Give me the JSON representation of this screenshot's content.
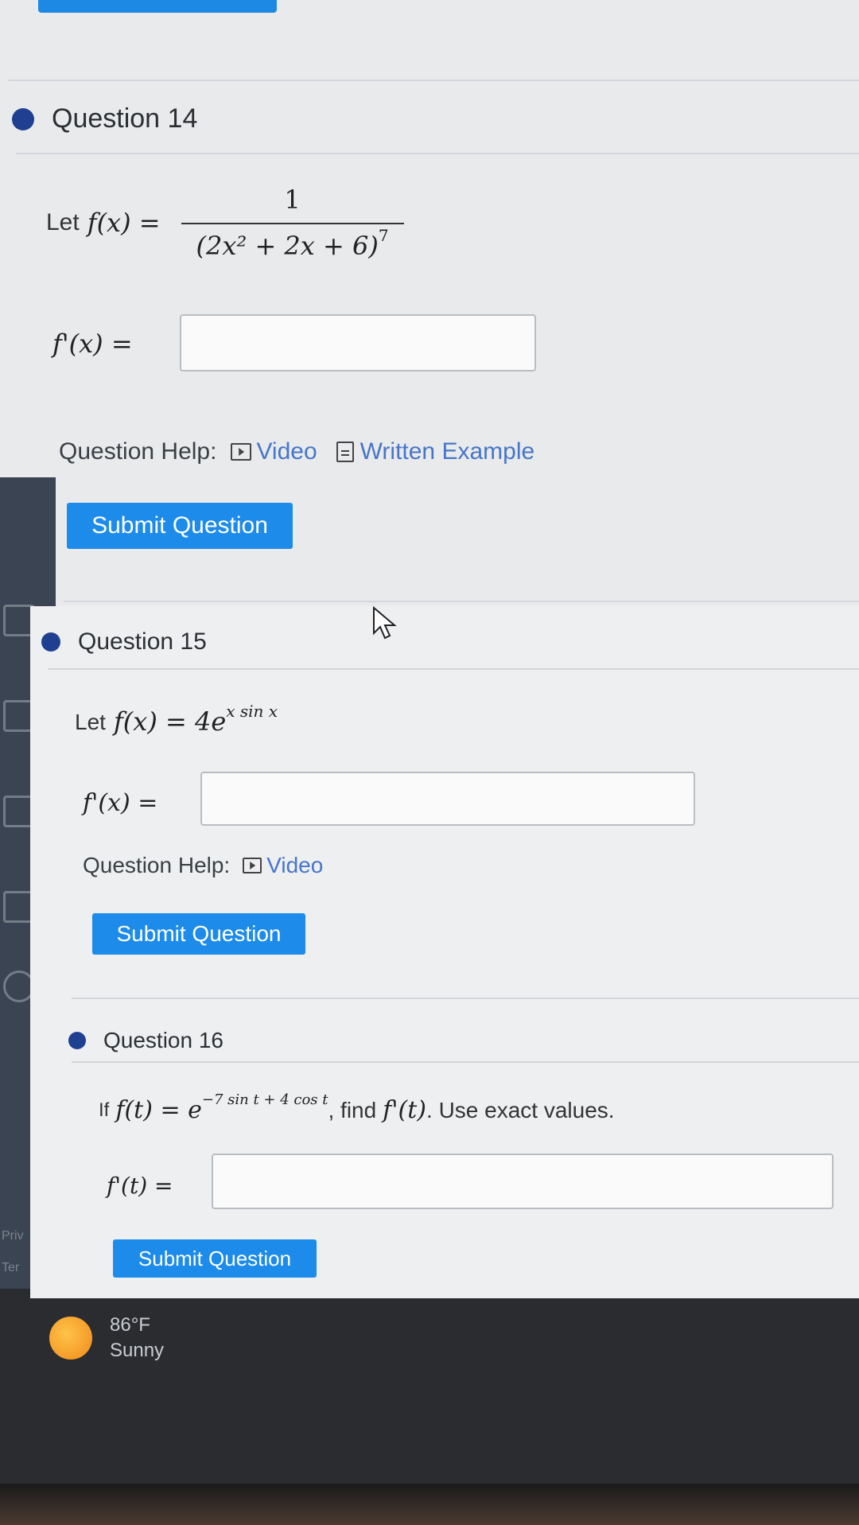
{
  "questions": [
    {
      "title": "Question 14",
      "prompt_prefix": "Let",
      "func": "f(x) =",
      "numerator": "1",
      "denominator": "(2x² + 2x + 6)",
      "exponent": "7",
      "answer_label": "f'(x) =",
      "answer_value": "",
      "help_label": "Question Help:",
      "help_links": [
        "Video",
        "Written Example"
      ],
      "submit_label": "Submit Question"
    },
    {
      "title": "Question 15",
      "prompt_prefix": "Let",
      "func": "f(x) = 4e",
      "exponent": "x sin x",
      "answer_label": "f'(x) =",
      "answer_value": "",
      "help_label": "Question Help:",
      "help_links": [
        "Video"
      ],
      "submit_label": "Submit Question"
    },
    {
      "title": "Question 16",
      "prompt_prefix": "If",
      "func": "f(t) = e",
      "exponent": "−7 sin t + 4 cos t",
      "prompt_suffix_1": ", find",
      "derivative": "f'(t)",
      "prompt_suffix_2": ". Use exact values.",
      "answer_label": "f'(t) =",
      "answer_value": "",
      "submit_label": "Submit Question"
    }
  ],
  "side_strip": {
    "text_1": "Priv",
    "text_2": "Ter"
  },
  "weather": {
    "temp": "86°F",
    "condition": "Sunny"
  },
  "colors": {
    "accent": "#1d8bea",
    "dot": "#1f3f91",
    "link": "#4676c9"
  }
}
